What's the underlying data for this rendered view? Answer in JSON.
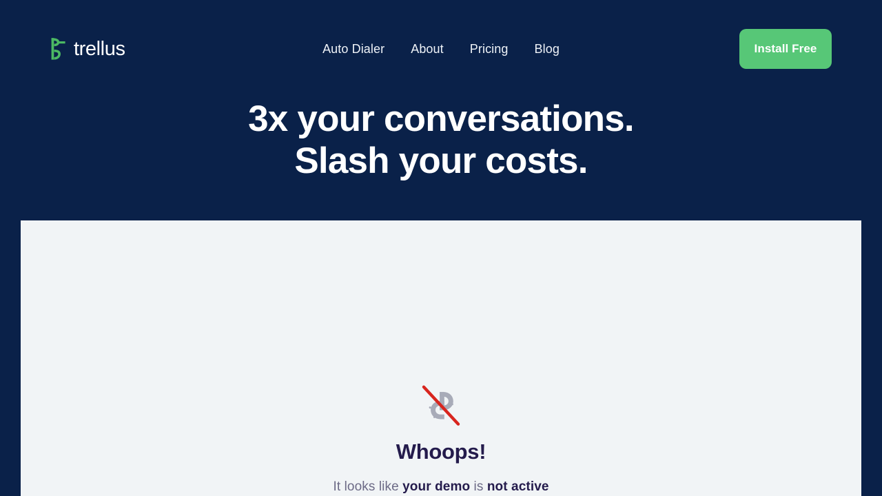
{
  "brand": {
    "name": "trellus",
    "mark_color": "#4cb963"
  },
  "nav": {
    "items": [
      {
        "label": "Auto Dialer"
      },
      {
        "label": "About"
      },
      {
        "label": "Pricing"
      },
      {
        "label": "Blog"
      }
    ]
  },
  "cta": {
    "label": "Install Free",
    "color": "#57c777"
  },
  "hero": {
    "line1": "3x your conversations.",
    "line2": "Slash your costs."
  },
  "panel": {
    "icon": "broken-link-icon",
    "icon_color": "#a8abb8",
    "slash_color": "#d8251e",
    "title": "Whoops!",
    "message_prefix": "It looks like ",
    "message_bold_1": "your demo",
    "message_middle": " is ",
    "message_bold_2": "not active",
    "background": "#f1f4f6"
  },
  "theme": {
    "header_background": "#0a2149",
    "title_color": "#241b4c"
  }
}
